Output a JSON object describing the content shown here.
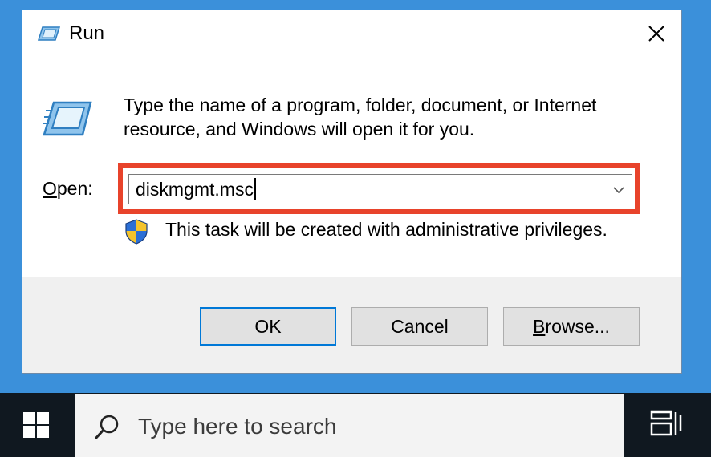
{
  "dialog": {
    "title": "Run",
    "description_line1": "Type the name of a program, folder, document, or Internet",
    "description_line2": "resource, and Windows will open it for you.",
    "open_label_accel": "O",
    "open_label_rest": "pen:",
    "open_value": "diskmgmt.msc",
    "admin_note": "This task will be created with administrative privileges.",
    "ok_label": "OK",
    "cancel_label": "Cancel",
    "browse_label_accel": "B",
    "browse_label_rest": "rowse..."
  },
  "taskbar": {
    "search_placeholder": "Type here to search"
  },
  "colors": {
    "highlight": "#e8432b",
    "accent": "#0078d7",
    "desktop": "#3b90da"
  },
  "icons": [
    "run-icon",
    "close-icon",
    "chevron-down-icon",
    "shield-icon",
    "windows-logo-icon",
    "search-icon",
    "task-view-icon"
  ]
}
